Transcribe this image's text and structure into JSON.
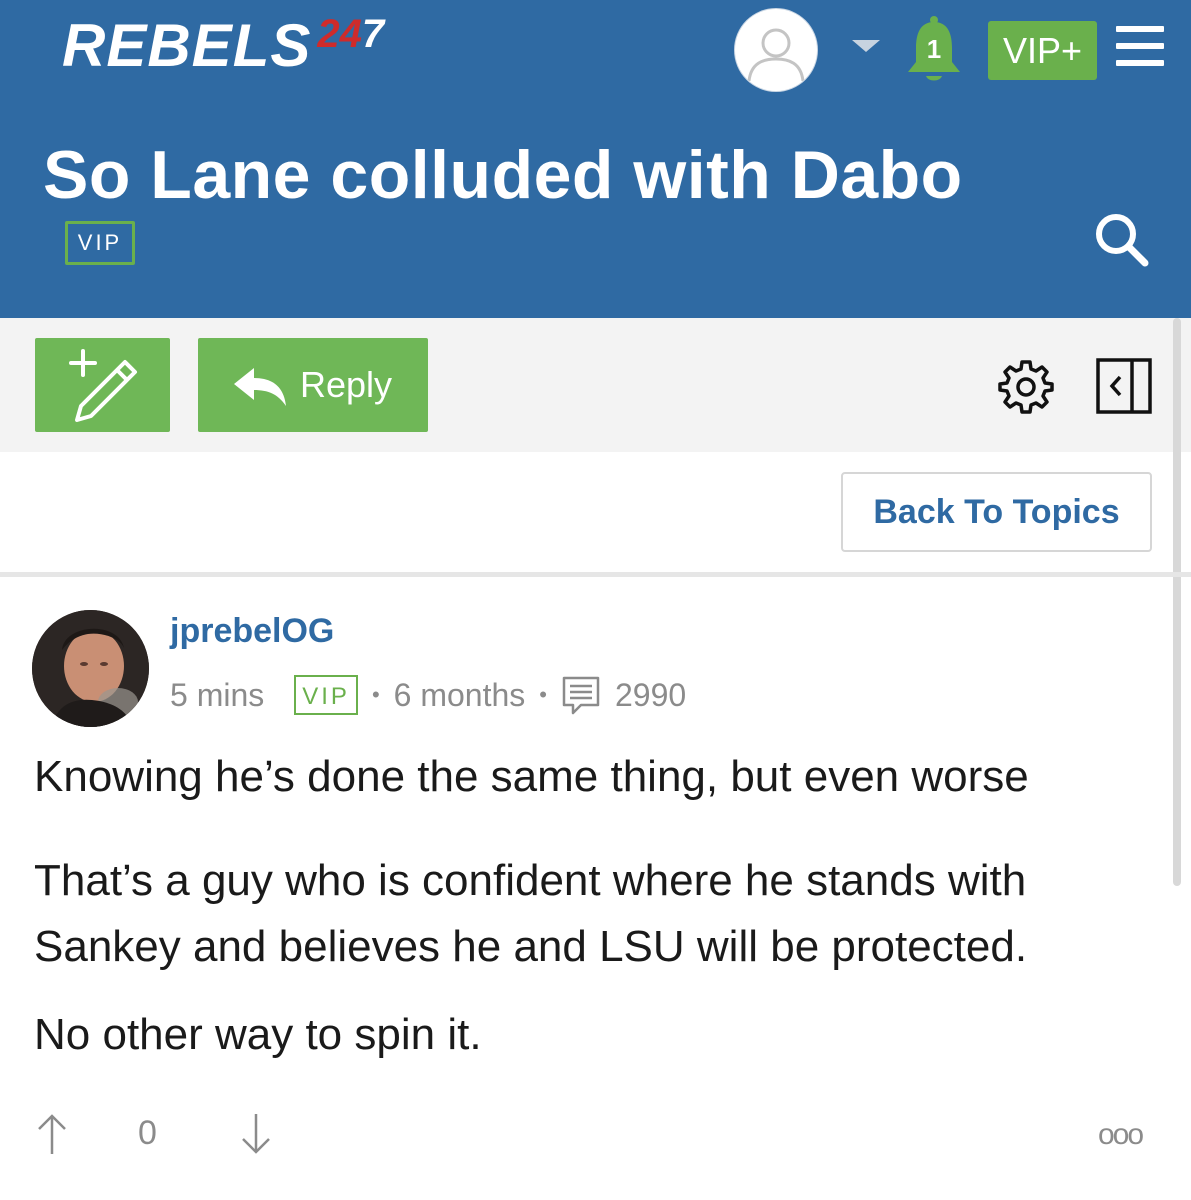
{
  "header": {
    "logo_main": "REBELS",
    "logo_num": {
      "d1": "2",
      "d2": "4",
      "d3": "7"
    },
    "notification_count": "1",
    "vip_plus_label": "VIP+",
    "thread_title": "So Lane colluded with Dabo",
    "vip_badge": "VIP"
  },
  "toolbar": {
    "reply_label": "Reply"
  },
  "nav": {
    "back_label": "Back To Topics"
  },
  "post": {
    "username": "jprebelOG",
    "time": "5 mins",
    "vip_badge": "VIP",
    "separator": "•",
    "member_since": "6 months",
    "post_count": "2990",
    "paragraphs": [
      "Knowing he’s done the same thing, but even worse",
      "That’s a guy who is confident where he stands with Sankey and believes he and LSU will be protected.",
      "No other way to spin it."
    ],
    "vote_count": "0",
    "more_label": "ooo"
  },
  "colors": {
    "header_blue": "#2f6aa3",
    "accent_green": "#6ab04c",
    "button_green": "#6fb757",
    "logo_red": "#cf2b2b"
  },
  "icons": [
    "avatar-placeholder-icon",
    "caret-down-icon",
    "bell-icon",
    "hamburger-menu-icon",
    "search-icon",
    "new-topic-pencil-icon",
    "reply-arrow-icon",
    "settings-gear-icon",
    "collapse-sidebar-icon",
    "comment-count-icon",
    "upvote-arrow-icon",
    "downvote-arrow-icon"
  ]
}
